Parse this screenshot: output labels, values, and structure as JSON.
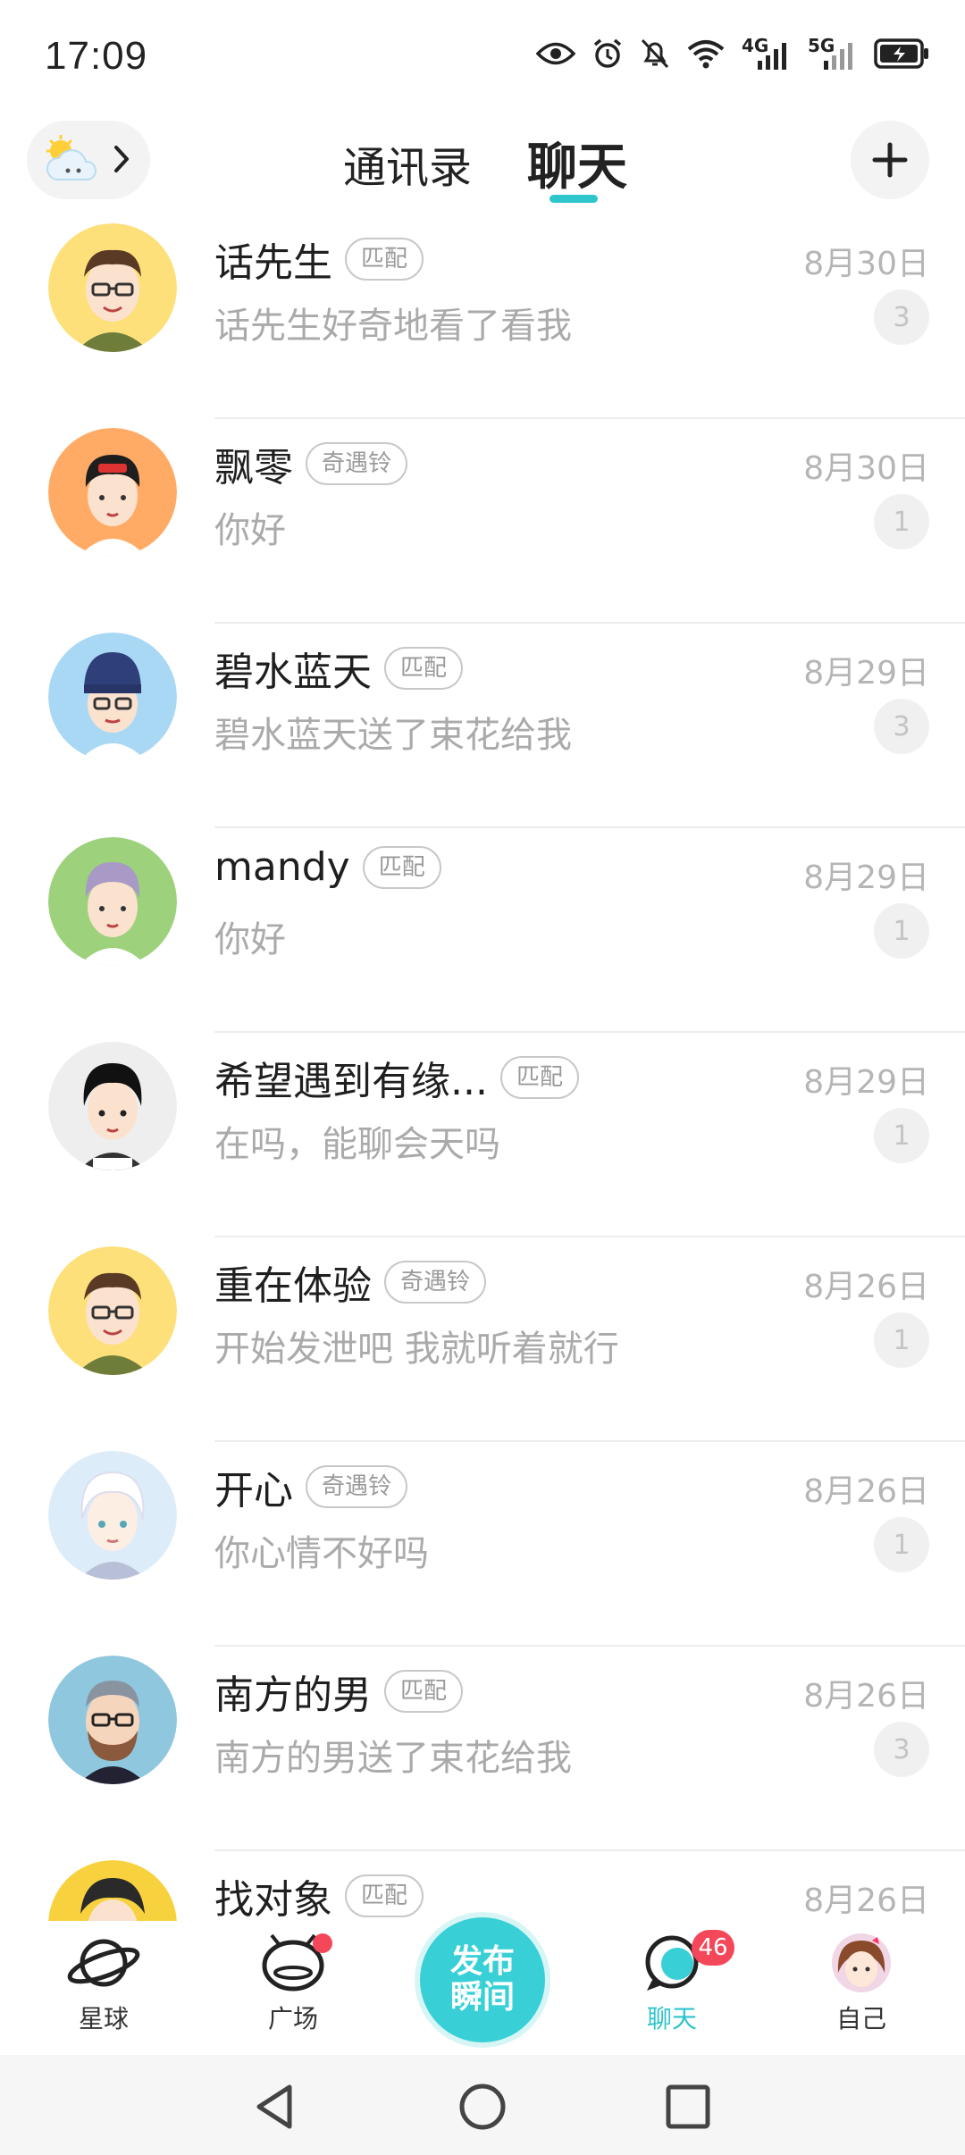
{
  "status_bar": {
    "time": "17:09",
    "net1": "4G",
    "net2": "5G"
  },
  "header": {
    "tabs": [
      {
        "label": "通讯录"
      },
      {
        "label": "聊天"
      }
    ]
  },
  "chats": [
    {
      "name": "话先生",
      "tag": "匹配",
      "date": "8月30日",
      "preview": "话先生好奇地看了看我",
      "unread": "3"
    },
    {
      "name": "飘零",
      "tag": "奇遇铃",
      "date": "8月30日",
      "preview": "你好",
      "unread": "1"
    },
    {
      "name": "碧水蓝天",
      "tag": "匹配",
      "date": "8月29日",
      "preview": "碧水蓝天送了束花给我",
      "unread": "3"
    },
    {
      "name": "mandy",
      "tag": "匹配",
      "date": "8月29日",
      "preview": "你好",
      "unread": "1"
    },
    {
      "name": "希望遇到有缘...",
      "tag": "匹配",
      "date": "8月29日",
      "preview": "在吗，能聊会天吗",
      "unread": "1"
    },
    {
      "name": "重在体验",
      "tag": "奇遇铃",
      "date": "8月26日",
      "preview": "开始发泄吧 我就听着就行",
      "unread": "1"
    },
    {
      "name": "开心",
      "tag": "奇遇铃",
      "date": "8月26日",
      "preview": "你心情不好吗",
      "unread": "1"
    },
    {
      "name": "南方的男",
      "tag": "匹配",
      "date": "8月26日",
      "preview": "南方的男送了束花给我",
      "unread": "3"
    },
    {
      "name": "找对象",
      "tag": "匹配",
      "date": "8月26日",
      "preview": "",
      "unread": ""
    }
  ],
  "bottom_nav": {
    "planet": "星球",
    "square": "广场",
    "publish_line1": "发布",
    "publish_line2": "瞬间",
    "chat": "聊天",
    "chat_badge": "46",
    "me": "自己"
  },
  "colors": {
    "accent": "#2ec5cc",
    "badge_red": "#f4475a"
  },
  "avatar_colors": [
    "#fde07a",
    "#ffab66",
    "#a9d8f5",
    "#9dd17c",
    "#eeeeee",
    "#fde07a",
    "#dcecf8",
    "#8fc7de",
    "#f7d23e"
  ]
}
